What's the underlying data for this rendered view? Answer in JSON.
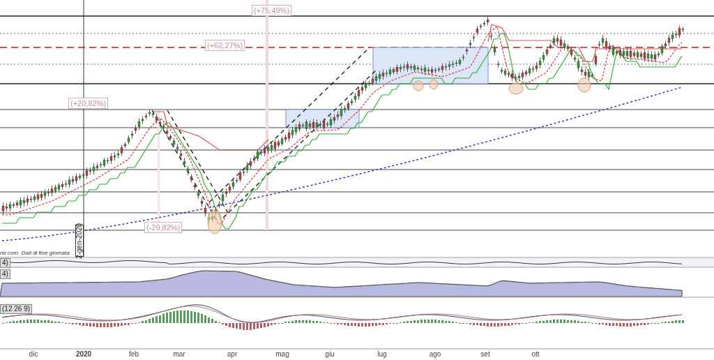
{
  "annotations": [
    {
      "text": "(+75,49%)"
    },
    {
      "text": "(+62,27%)"
    },
    {
      "text": "(+20,82%)"
    },
    {
      "text": "(-29,82%)"
    }
  ],
  "date_marker": "2-gen-2020",
  "source_note": "ne.com  Dati di fine giornata",
  "indicator_panels": [
    {
      "label": "4)"
    },
    {
      "label": "4)"
    },
    {
      "label": "(12 26 9)"
    }
  ],
  "x_axis": [
    {
      "label": "dic",
      "bold": false
    },
    {
      "label": "2020",
      "bold": true
    },
    {
      "label": "feb",
      "bold": false
    },
    {
      "label": "mar",
      "bold": false
    },
    {
      "label": "apr",
      "bold": false
    },
    {
      "label": "mag",
      "bold": false
    },
    {
      "label": "giu",
      "bold": false
    },
    {
      "label": "lug",
      "bold": false
    },
    {
      "label": "ago",
      "bold": false
    },
    {
      "label": "set",
      "bold": false
    },
    {
      "label": "ott",
      "bold": false
    }
  ]
}
